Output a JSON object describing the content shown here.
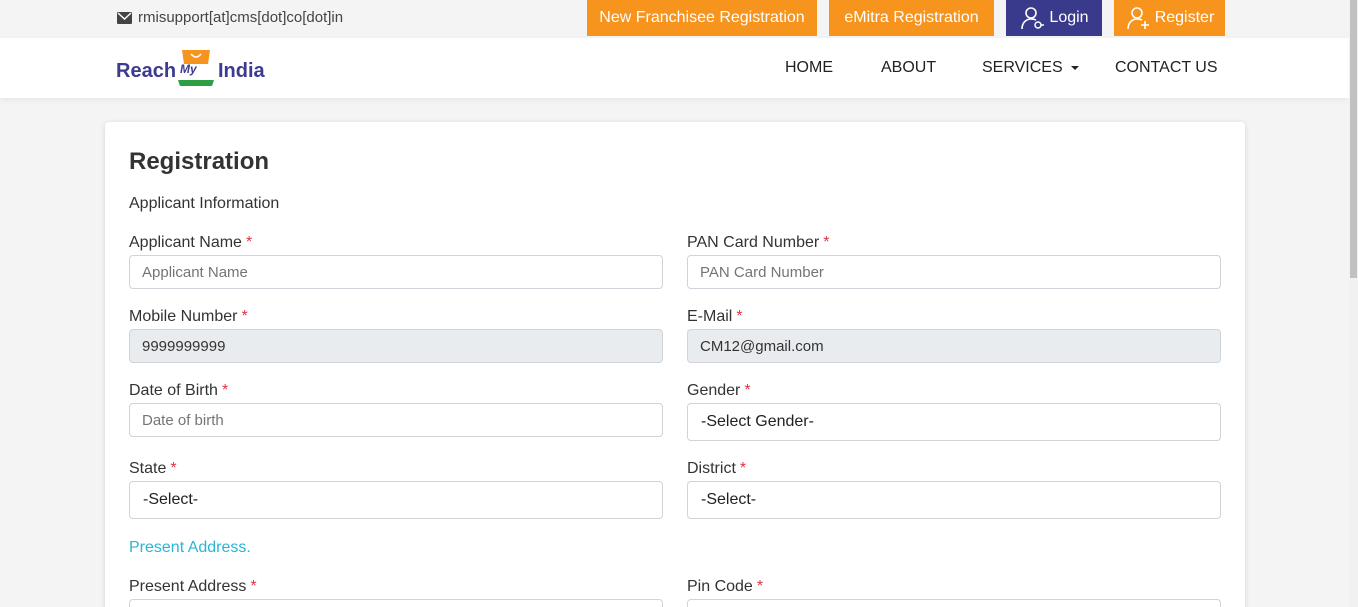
{
  "topbar": {
    "email": "rmisupport[at]cms[dot]co[dot]in",
    "buttons": {
      "franchisee": "New Franchisee Registration",
      "emitra": "eMitra Registration",
      "login": "Login",
      "register": "Register"
    },
    "icons": {
      "mail": "envelope-icon",
      "login": "user-key-icon",
      "register": "user-plus-icon"
    },
    "colors": {
      "orange": "#f7941d",
      "navy": "#3a3a8c"
    }
  },
  "logo": {
    "part1": "Reach",
    "part2": "My",
    "part3": "India"
  },
  "nav": {
    "home": "HOME",
    "about": "ABOUT",
    "services": "SERVICES",
    "contact": "CONTACT US"
  },
  "form": {
    "title": "Registration",
    "section": "Applicant Information",
    "required_mark": "*",
    "fields": {
      "applicant_name": {
        "label": "Applicant Name",
        "placeholder": "Applicant Name",
        "value": ""
      },
      "pan": {
        "label": "PAN Card Number",
        "placeholder": "PAN Card Number",
        "value": ""
      },
      "mobile": {
        "label": "Mobile Number",
        "value": "9999999999"
      },
      "email": {
        "label": "E-Mail",
        "value": "CM12@gmail.com"
      },
      "dob": {
        "label": "Date of Birth",
        "placeholder": "Date of birth",
        "value": ""
      },
      "gender": {
        "label": "Gender",
        "selected": "-Select Gender-"
      },
      "state": {
        "label": "State",
        "selected": "-Select-"
      },
      "district": {
        "label": "District",
        "selected": "-Select-"
      },
      "present_address": {
        "label": "Present Address"
      },
      "pin": {
        "label": "Pin Code"
      }
    },
    "present_address_section": "Present Address."
  }
}
